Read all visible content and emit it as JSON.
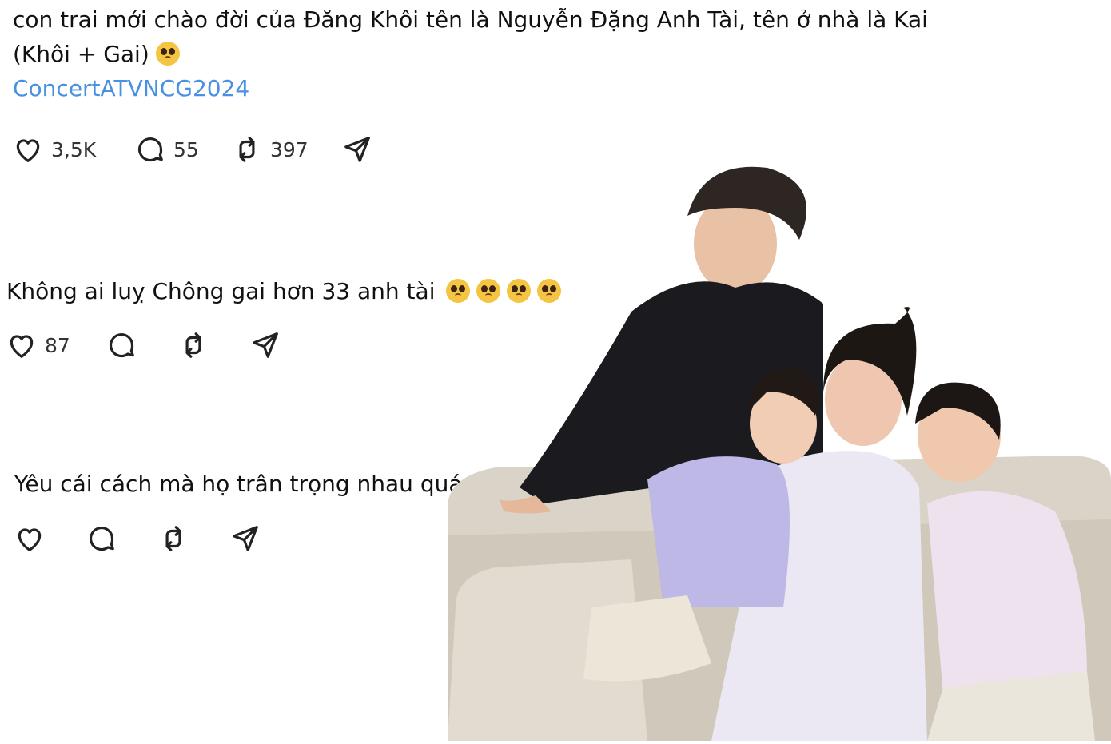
{
  "posts": [
    {
      "text_line1": "con trai mới chào đời của Đăng Khôi tên là Nguyễn Đặng Anh Tài, tên ở nhà là Kai",
      "text_line2": "(Khôi + Gai)",
      "hashtag": "ConcertATVNCG2024",
      "likes": "3,5K",
      "comments": "55",
      "reposts": "397"
    },
    {
      "text": "Không ai luỵ Chông gai hơn 33 anh tài",
      "likes": "87"
    },
    {
      "text": "Yêu cái cách mà họ trân trọng nhau quá huhuh"
    }
  ],
  "icons": [
    "heart-icon",
    "comment-icon",
    "repost-icon",
    "share-icon",
    "pleading-face-emoji"
  ],
  "colors": {
    "hashtag": "#4a90e2",
    "text": "#111111",
    "emoji": "#f4c542"
  }
}
